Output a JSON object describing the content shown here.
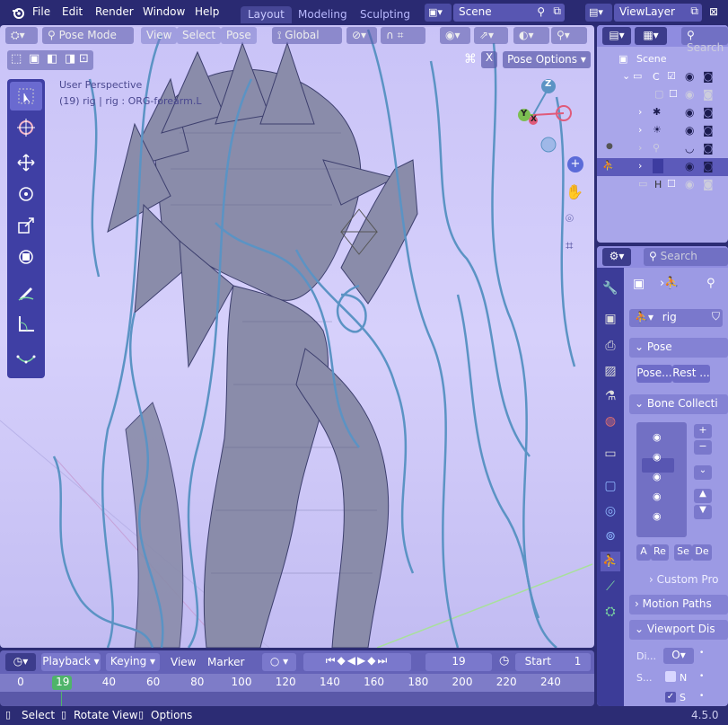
{
  "menu": {
    "file": "File",
    "edit": "Edit",
    "render": "Render",
    "window": "Window",
    "help": "Help"
  },
  "workspaces": {
    "layout": "Layout",
    "modeling": "Modeling",
    "sculpting": "Sculpting"
  },
  "scene": "Scene",
  "viewlayer": "ViewLayer",
  "vp": {
    "mode": "Pose Mode",
    "view": "View",
    "select": "Select",
    "pose": "Pose",
    "orientation": "Global",
    "pose_options": "Pose Options",
    "overlay_title": "User Perspective",
    "overlay_sub": "(19) rig | rig : ORG-forearm.L",
    "gizmo": {
      "z": "Z",
      "y": "Y",
      "x": "X"
    }
  },
  "outliner": {
    "search": "Search",
    "scene_row": "Scene",
    "collection": "C",
    "h_row": "H"
  },
  "props": {
    "search": "Search",
    "object": "rig",
    "pose_panel": "Pose",
    "pose_btn": "Pose...",
    "rest_btn": "Rest ...",
    "bone_collections": "Bone Collecti",
    "a_btn": "A",
    "re_btn": "Re",
    "se_btn": "Se",
    "de_btn": "De",
    "custom_props": "Custom Pro",
    "motion_paths": "Motion Paths",
    "viewport_display": "Viewport Dis",
    "di_label": "Di...",
    "di_val": "O",
    "s1_label": "S...",
    "n_label": "N",
    "s2_label": "S"
  },
  "timeline": {
    "playback": "Playback",
    "keying": "Keying",
    "view": "View",
    "marker": "Marker",
    "current_frame": "19",
    "start_label": "Start",
    "start_val": "1",
    "ticks": [
      "0",
      "19",
      "40",
      "60",
      "80",
      "100",
      "120",
      "140",
      "160",
      "180",
      "200",
      "220",
      "240"
    ]
  },
  "status": {
    "select": "Select",
    "rotate": "Rotate View",
    "options": "Options",
    "version": "4.5.0"
  },
  "colors": {
    "accent": "#4a4aa2",
    "viewport_bg": "#d6d0fb",
    "wire": "#5b93c4",
    "frame_marker": "#4fb46a"
  }
}
